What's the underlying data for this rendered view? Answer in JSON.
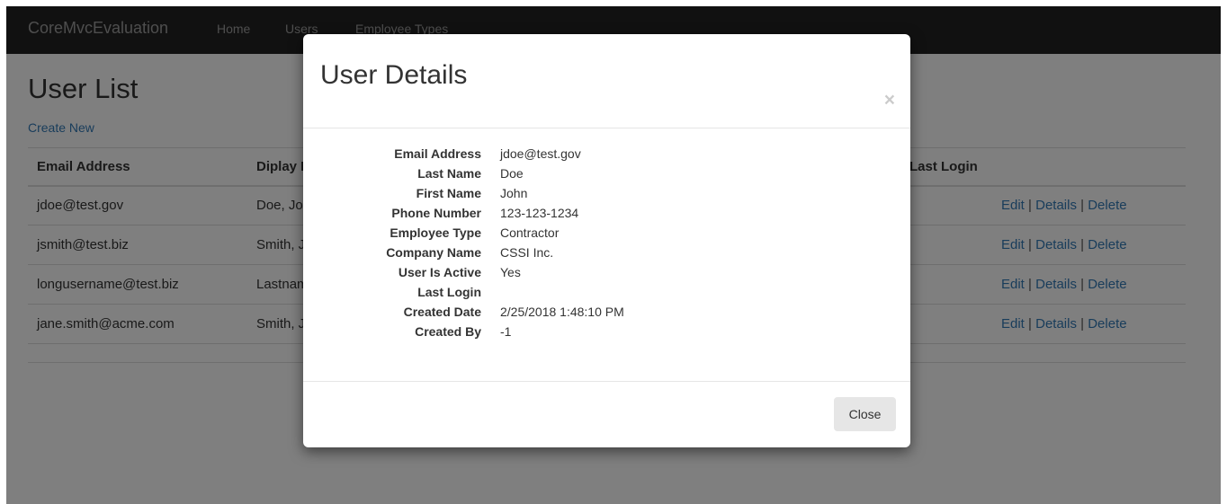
{
  "navbar": {
    "brand": "CoreMvcEvaluation",
    "links": [
      "Home",
      "Users",
      "Employee Types"
    ]
  },
  "page": {
    "title": "User List",
    "create_link": "Create New"
  },
  "table": {
    "headers": [
      "Email Address",
      "Diplay Name",
      "Last Login"
    ],
    "rows": [
      {
        "email": "jdoe@test.gov",
        "display": "Doe, John"
      },
      {
        "email": "jsmith@test.biz",
        "display": "Smith, J"
      },
      {
        "email": "longusername@test.biz",
        "display": "Lastname"
      },
      {
        "email": "jane.smith@acme.com",
        "display": "Smith, J"
      }
    ],
    "actions": {
      "edit": "Edit",
      "details": "Details",
      "delete": "Delete",
      "separator": "|"
    }
  },
  "modal": {
    "title": "User Details",
    "close_symbol": "×",
    "close_button": "Close",
    "fields": [
      {
        "label": "Email Address",
        "value": "jdoe@test.gov"
      },
      {
        "label": "Last Name",
        "value": "Doe"
      },
      {
        "label": "First Name",
        "value": "John"
      },
      {
        "label": "Phone Number",
        "value": "123-123-1234"
      },
      {
        "label": "Employee Type",
        "value": "Contractor"
      },
      {
        "label": "Company Name",
        "value": "CSSI Inc."
      },
      {
        "label": "User Is Active",
        "value": "Yes"
      },
      {
        "label": "Last Login",
        "value": ""
      },
      {
        "label": "Created Date",
        "value": "2/25/2018 1:48:10 PM"
      },
      {
        "label": "Created By",
        "value": "-1"
      }
    ]
  },
  "colors": {
    "navbar_bg": "#222222",
    "link": "#337ab7",
    "backdrop": "rgba(0,0,0,0.5)"
  }
}
